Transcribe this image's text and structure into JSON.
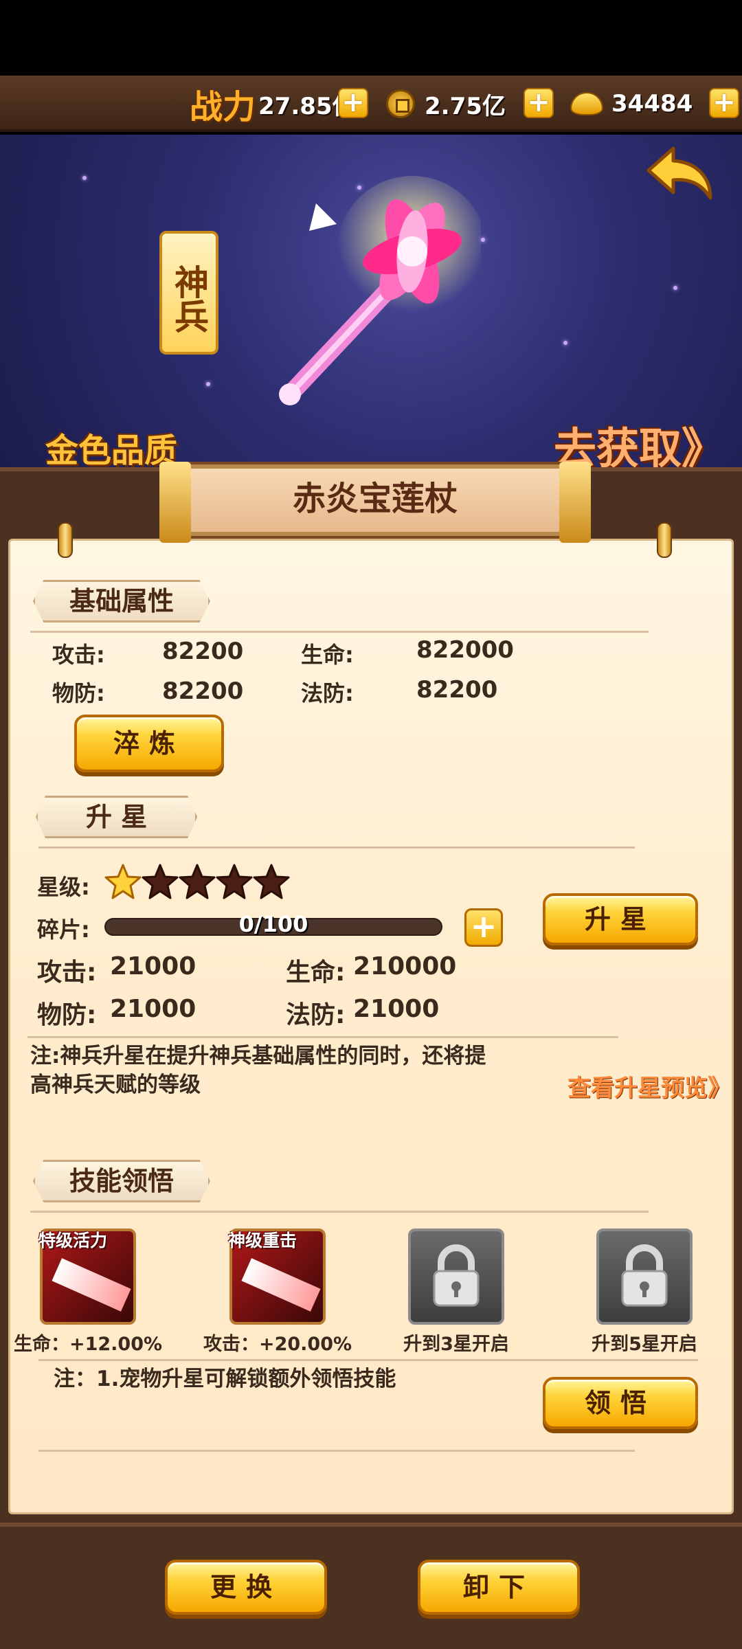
{
  "topbar": {
    "power_label": "战力",
    "power_value": "27.85亿",
    "coins_value": "2.75亿",
    "gold_value": "34484"
  },
  "hero": {
    "tag": "神兵",
    "quality": "金色品质",
    "get_link": "去获取》"
  },
  "item": {
    "name": "赤炎宝莲杖"
  },
  "basic": {
    "section_title": "基础属性",
    "attack_label": "攻击:",
    "attack_value": "82200",
    "hp_label": "生命:",
    "hp_value": "822000",
    "pdef_label": "物防:",
    "pdef_value": "82200",
    "mdef_label": "法防:",
    "mdef_value": "82200",
    "refine_button": "淬炼"
  },
  "star_up": {
    "section_title": "升 星",
    "level_label": "星级:",
    "stars_filled": 1,
    "stars_total": 5,
    "fragment_label": "碎片:",
    "fragment_text": "0/100",
    "fragment_progress": 0,
    "star_up_button": "升星",
    "attack_label": "攻击:",
    "attack_value": "21000",
    "hp_label": "生命:",
    "hp_value": "210000",
    "pdef_label": "物防:",
    "pdef_value": "21000",
    "mdef_label": "法防:",
    "mdef_value": "21000",
    "note_line1": "注:神兵升星在提升神兵基础属性的同时，还将提",
    "note_line2": "高神兵天赋的等级",
    "preview_link": "查看升星预览》"
  },
  "skills": {
    "section_title": "技能领悟",
    "items": [
      {
        "name": "特级活力",
        "caption": "生命：+12.00%"
      },
      {
        "name": "神级重击",
        "caption": "攻击：+20.00%"
      },
      {
        "name": "",
        "caption": "升到3星开启"
      },
      {
        "name": "",
        "caption": "升到5星开启"
      }
    ],
    "note": "注：1.宠物升星可解锁额外领悟技能",
    "comprehend_button": "领悟"
  },
  "bottom": {
    "replace_button": "更换",
    "unequip_button": "卸下"
  },
  "colors": {
    "gold": "#ffc23a",
    "brown_frame": "#4c3020",
    "parchment": "#fff3dc",
    "night_sky": "#2d2d70"
  }
}
